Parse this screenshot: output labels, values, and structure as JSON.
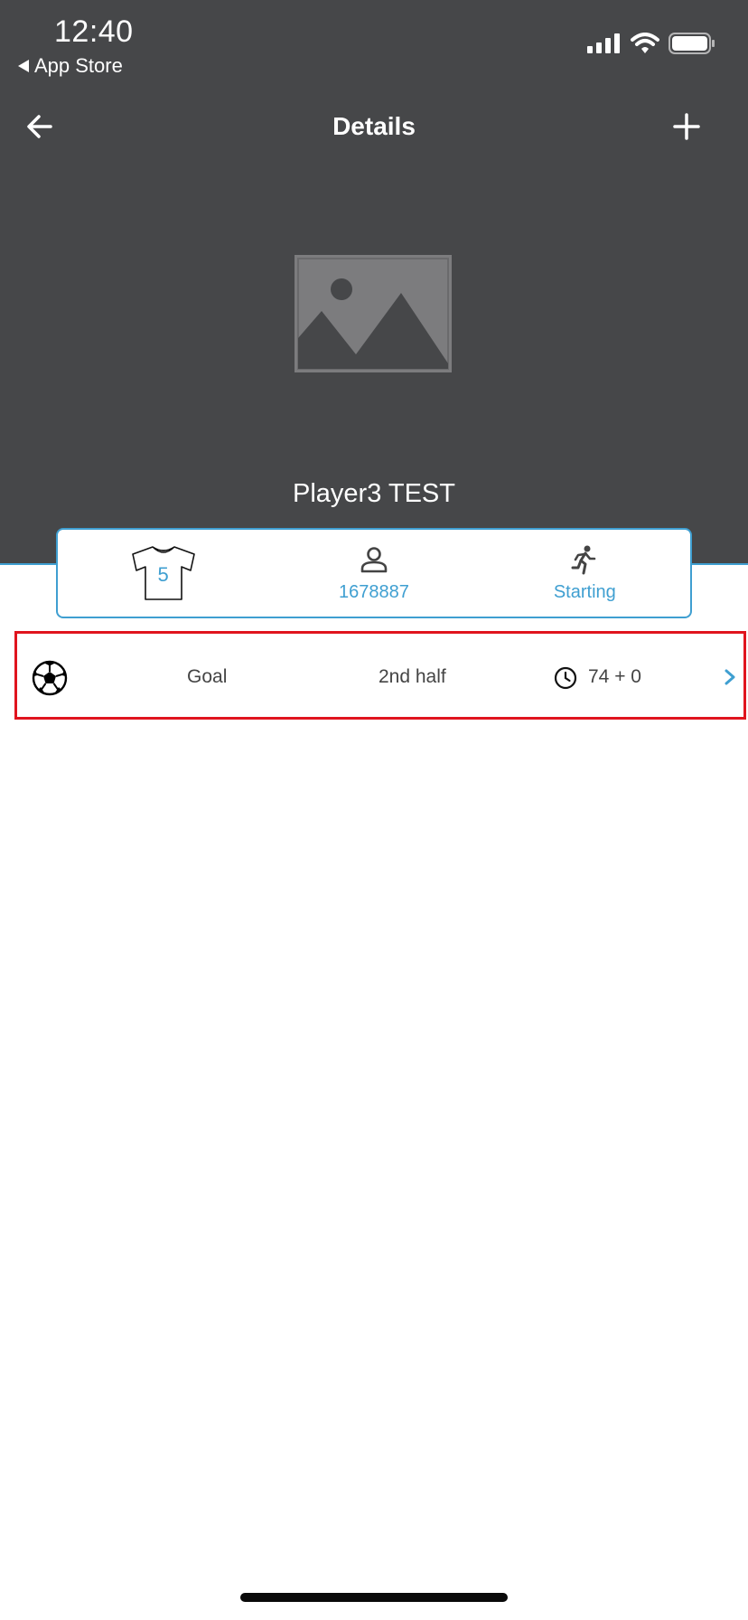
{
  "status_bar": {
    "time": "12:40",
    "back_app": "App Store",
    "icons": [
      "signal-icon",
      "wifi-icon",
      "battery-icon"
    ]
  },
  "nav": {
    "title": "Details",
    "back_icon": "arrow-left-icon",
    "add_icon": "plus-icon"
  },
  "player": {
    "photo_icon": "image-placeholder-icon",
    "name": "Player3 TEST"
  },
  "info_card": {
    "jersey_number": "5",
    "id_icon": "person-icon",
    "id_value": "1678887",
    "status_icon": "running-person-icon",
    "status_label": "Starting"
  },
  "event": {
    "icon": "soccer-ball-icon",
    "type": "Goal",
    "period": "2nd half",
    "clock_icon": "clock-icon",
    "time": "74 + 0",
    "chevron_icon": "chevron-right-icon"
  },
  "colors": {
    "header_bg": "#464749",
    "accent": "#3f9fd1",
    "highlight": "#e0141e"
  }
}
